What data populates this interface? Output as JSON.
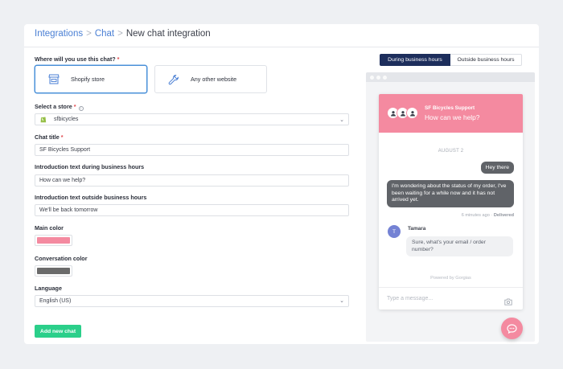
{
  "breadcrumb": {
    "items": [
      "Integrations",
      "Chat"
    ],
    "separator": ">",
    "current": "New chat integration"
  },
  "form": {
    "usage": {
      "label": "Where will you use this chat?",
      "required_mark": "*",
      "options": [
        {
          "label": "Shopify store",
          "icon": "store-icon",
          "selected": true
        },
        {
          "label": "Any other website",
          "icon": "wrench-icon",
          "selected": false
        }
      ]
    },
    "store": {
      "label": "Select a store",
      "required_mark": "*",
      "info_icon": "i",
      "value": "sfbicycles",
      "icon": "shopify-icon"
    },
    "chat_title": {
      "label": "Chat title",
      "required_mark": "*",
      "value": "SF Bicycles Support"
    },
    "intro_business": {
      "label": "Introduction text during business hours",
      "value": "How can we help?"
    },
    "intro_outside": {
      "label": "Introduction text outside business hours",
      "value": "We'll be back tomorrow"
    },
    "main_color": {
      "label": "Main color",
      "value": "#f48aa0"
    },
    "conversation_color": {
      "label": "Conversation color",
      "value": "#6b6b6b"
    },
    "language": {
      "label": "Language",
      "value": "English (US)"
    },
    "submit_label": "Add new chat"
  },
  "preview": {
    "tabs": [
      {
        "label": "During business hours",
        "active": true
      },
      {
        "label": "Outside business hours",
        "active": false
      }
    ],
    "chat": {
      "name": "SF Bicycles Support",
      "subtitle": "How can we help?",
      "date": "AUGUST 2",
      "messages_out": [
        "Hey there",
        "I'm wondering about the status of my order, I've been waiting for a while now and it has not arrived yet."
      ],
      "meta_time": "6 minutes ago",
      "meta_status": "Delivered",
      "agent_initial": "T",
      "agent_name": "Tamara",
      "agent_message": "Sure, what's your email / order number?",
      "powered_by": "Powered by Gorgias",
      "input_placeholder": "Type a message..."
    }
  },
  "colors": {
    "accent": "#4a7fd4",
    "primary_button": "#2bcf8a",
    "tab_active": "#1d2e5c",
    "chat_header": "#f48aa0"
  }
}
